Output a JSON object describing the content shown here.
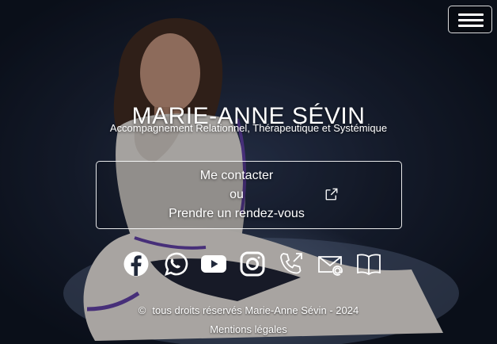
{
  "menu": {
    "icon": "hamburger-icon"
  },
  "hero": {
    "name": "MARIE-ANNE SÉVIN",
    "tagline": "Accompagnement Relationnel, Thérapeutique et Systémique"
  },
  "contact": {
    "line1": "Me contacter",
    "line2": "ou",
    "line3": "Prendre un rendez-vous",
    "icon": "external-link-icon"
  },
  "socials": [
    {
      "icon": "facebook-icon"
    },
    {
      "icon": "whatsapp-icon"
    },
    {
      "icon": "youtube-icon"
    },
    {
      "icon": "instagram-icon"
    },
    {
      "icon": "phone-icon"
    },
    {
      "icon": "email-icon"
    },
    {
      "icon": "book-icon"
    }
  ],
  "footer": {
    "copyright_symbol": "©",
    "copyright": "tous droits réservés Marie-Anne Sévin - 2024",
    "legal": "Mentions légales"
  },
  "colors": {
    "background": "#161d2e",
    "text": "#ffffff"
  }
}
